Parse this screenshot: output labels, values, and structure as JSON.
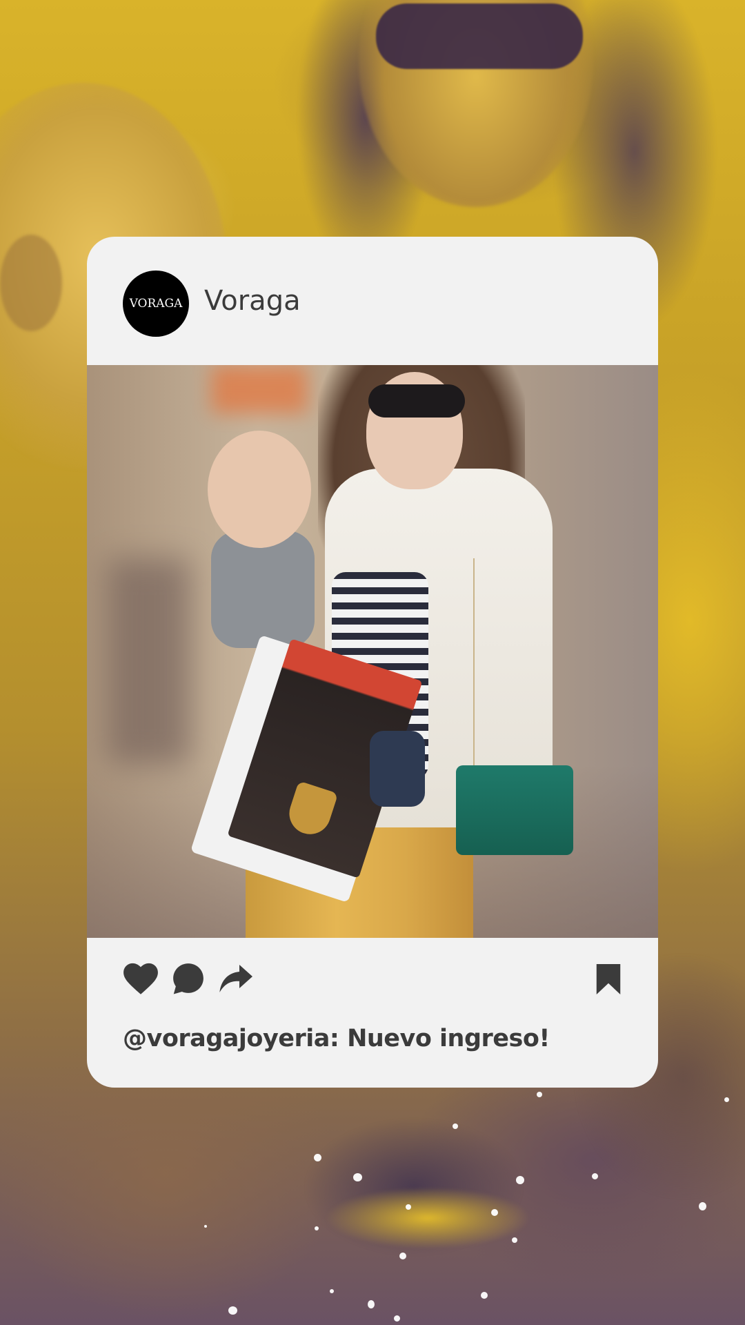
{
  "account": {
    "avatar_text": "VORAGA",
    "name": "Voraga"
  },
  "post": {
    "caption": "@voragajoyeria: Nuevo ingreso!",
    "image_alt": ""
  },
  "actions": {
    "icons": [
      "heart-icon",
      "comment-icon",
      "share-icon",
      "bookmark-icon"
    ]
  },
  "colors": {
    "card": "#f2f2f2",
    "text": "#3b3b3b",
    "accent_yellow": "#d9b32a",
    "accent_purple": "#6a5264"
  }
}
